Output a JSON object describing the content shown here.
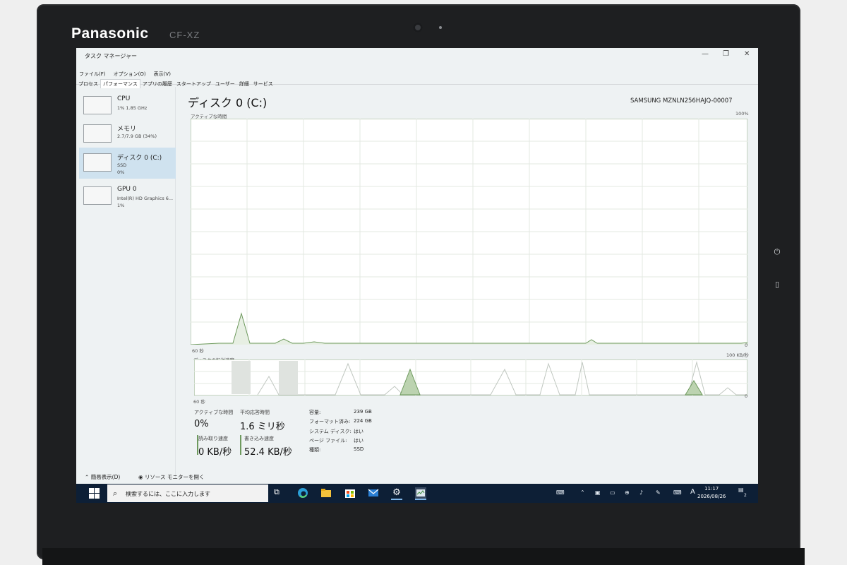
{
  "device": {
    "brand": "Panasonic",
    "model": "CF-XZ"
  },
  "window": {
    "title": "タスク マネージャー",
    "menu": [
      "ファイル(F)",
      "オプション(O)",
      "表示(V)"
    ],
    "tabs": [
      "プロセス",
      "パフォーマンス",
      "アプリの履歴",
      "スタートアップ",
      "ユーザー",
      "詳細",
      "サービス"
    ],
    "active_tab": "パフォーマンス"
  },
  "sidebar": {
    "items": [
      {
        "title": "CPU",
        "line1": "1%  1.85 GHz",
        "line2": ""
      },
      {
        "title": "メモリ",
        "line1": "2.7/7.9 GB (34%)",
        "line2": ""
      },
      {
        "title": "ディスク 0 (C:)",
        "line1": "SSD",
        "line2": "0%"
      },
      {
        "title": "GPU 0",
        "line1": "Intel(R) HD Graphics 6...",
        "line2": "1%"
      }
    ],
    "selected": "ディスク 0 (C:)"
  },
  "main": {
    "title": "ディスク 0 (C:)",
    "device_name": "SAMSUNG MZNLN256HAJQ-00007",
    "graph1": {
      "label": "アクティブな時間",
      "max": "100%",
      "time": "60 秒",
      "min": "0"
    },
    "graph2": {
      "label": "ディスクの転送速度",
      "max": "100 KB/秒",
      "time": "60 秒",
      "min": "0"
    },
    "stats": {
      "active_label": "アクティブな時間",
      "active_value": "0%",
      "resp_label": "平均応答時間",
      "resp_value": "1.6 ミリ秒",
      "read_label": "読み取り速度",
      "read_value": "0 KB/秒",
      "write_label": "書き込み速度",
      "write_value": "52.4 KB/秒"
    },
    "properties": [
      {
        "key": "容量:",
        "value": "239 GB"
      },
      {
        "key": "フォーマット済み:",
        "value": "224 GB"
      },
      {
        "key": "システム ディスク:",
        "value": "はい"
      },
      {
        "key": "ページ ファイル:",
        "value": "はい"
      },
      {
        "key": "種類:",
        "value": "SSD"
      }
    ],
    "footer": {
      "simple_view": "簡易表示(D)",
      "resource_monitor": "リソース モニターを開く"
    }
  },
  "taskbar": {
    "search_placeholder": "検索するには、ここに入力します",
    "time": "11:17",
    "date": "2026/08/26",
    "ime": "A",
    "notification_count": "2"
  },
  "colors": {
    "accent": "#0078d7",
    "taskbar": "#0d1f36",
    "graph_line": "#4f8a3c",
    "selected": "#cfe2ef"
  }
}
